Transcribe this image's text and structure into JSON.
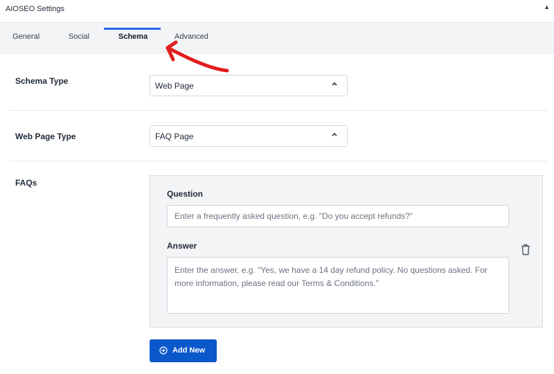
{
  "panel": {
    "title": "AIOSEO Settings",
    "collapse_icon": "caret-up-icon"
  },
  "tabs": [
    {
      "label": "General",
      "active": false
    },
    {
      "label": "Social",
      "active": false
    },
    {
      "label": "Schema",
      "active": true
    },
    {
      "label": "Advanced",
      "active": false
    }
  ],
  "schema_type": {
    "label": "Schema Type",
    "value": "Web Page",
    "icon": "chevron-up-icon"
  },
  "web_page_type": {
    "label": "Web Page Type",
    "value": "FAQ Page",
    "icon": "chevron-up-icon"
  },
  "faqs": {
    "label": "FAQs",
    "question_label": "Question",
    "question_placeholder": "Enter a frequently asked question, e.g. \"Do you accept refunds?\"",
    "answer_label": "Answer",
    "answer_placeholder": "Enter the answer, e.g. \"Yes, we have a 14 day refund policy. No questions asked. For more information, please read our Terms & Conditions.\"",
    "delete_icon": "trash-icon",
    "add_label": "Add New",
    "add_icon": "plus-circle-icon"
  },
  "colors": {
    "accent": "#2563eb",
    "button": "#0a58ca",
    "annotation": "#e11d1d",
    "tab_bar": "#f3f4f6"
  }
}
